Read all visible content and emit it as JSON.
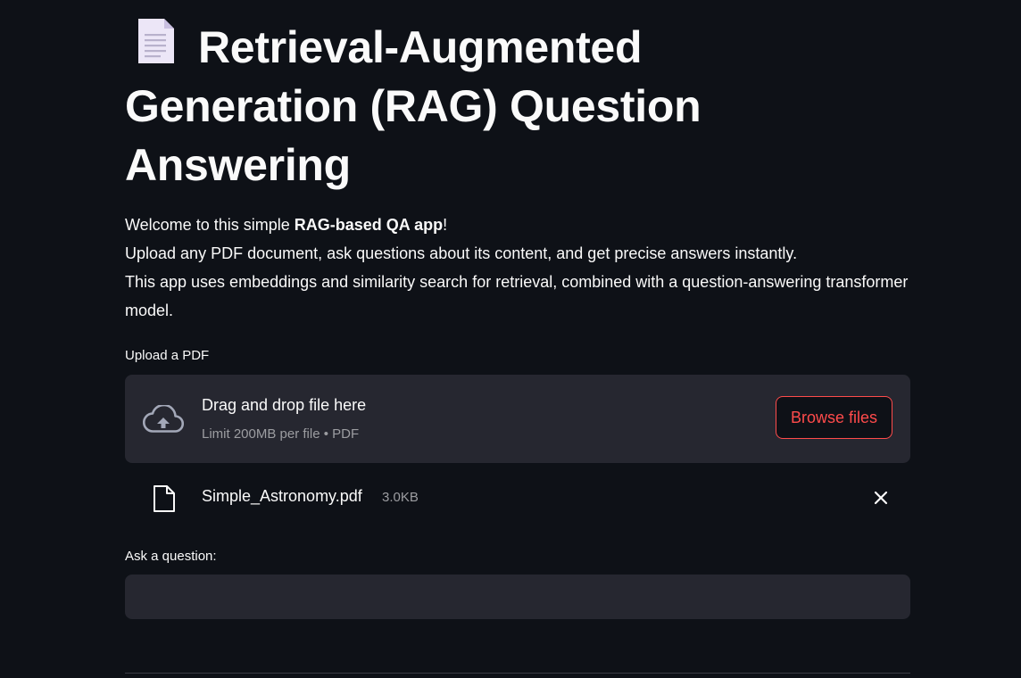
{
  "header": {
    "icon": "page-facing-up-emoji",
    "title": "Retrieval-Augmented Generation (RAG) Question Answering"
  },
  "intro": {
    "line1_prefix": "Welcome to this simple ",
    "line1_bold": "RAG-based QA app",
    "line1_suffix": "!",
    "line2": "Upload any PDF document, ask questions about its content, and get precise answers instantly.",
    "line3": "This app uses embeddings and similarity search for retrieval, combined with a question-answering transformer model."
  },
  "uploader": {
    "label": "Upload a PDF",
    "icon": "cloud-upload-icon",
    "drop_text": "Drag and drop file here",
    "limit_text": "Limit 200MB per file • PDF",
    "browse_label": "Browse files"
  },
  "uploaded_file": {
    "icon": "file-icon",
    "name": "Simple_Astronomy.pdf",
    "size": "3.0KB",
    "remove_icon": "close-icon"
  },
  "question": {
    "label": "Ask a question:",
    "value": "",
    "placeholder": ""
  },
  "colors": {
    "background": "#0e1117",
    "surface": "#262730",
    "accent": "#ff4b4b",
    "text": "#fafafa",
    "muted_text": "#9c9da1"
  }
}
